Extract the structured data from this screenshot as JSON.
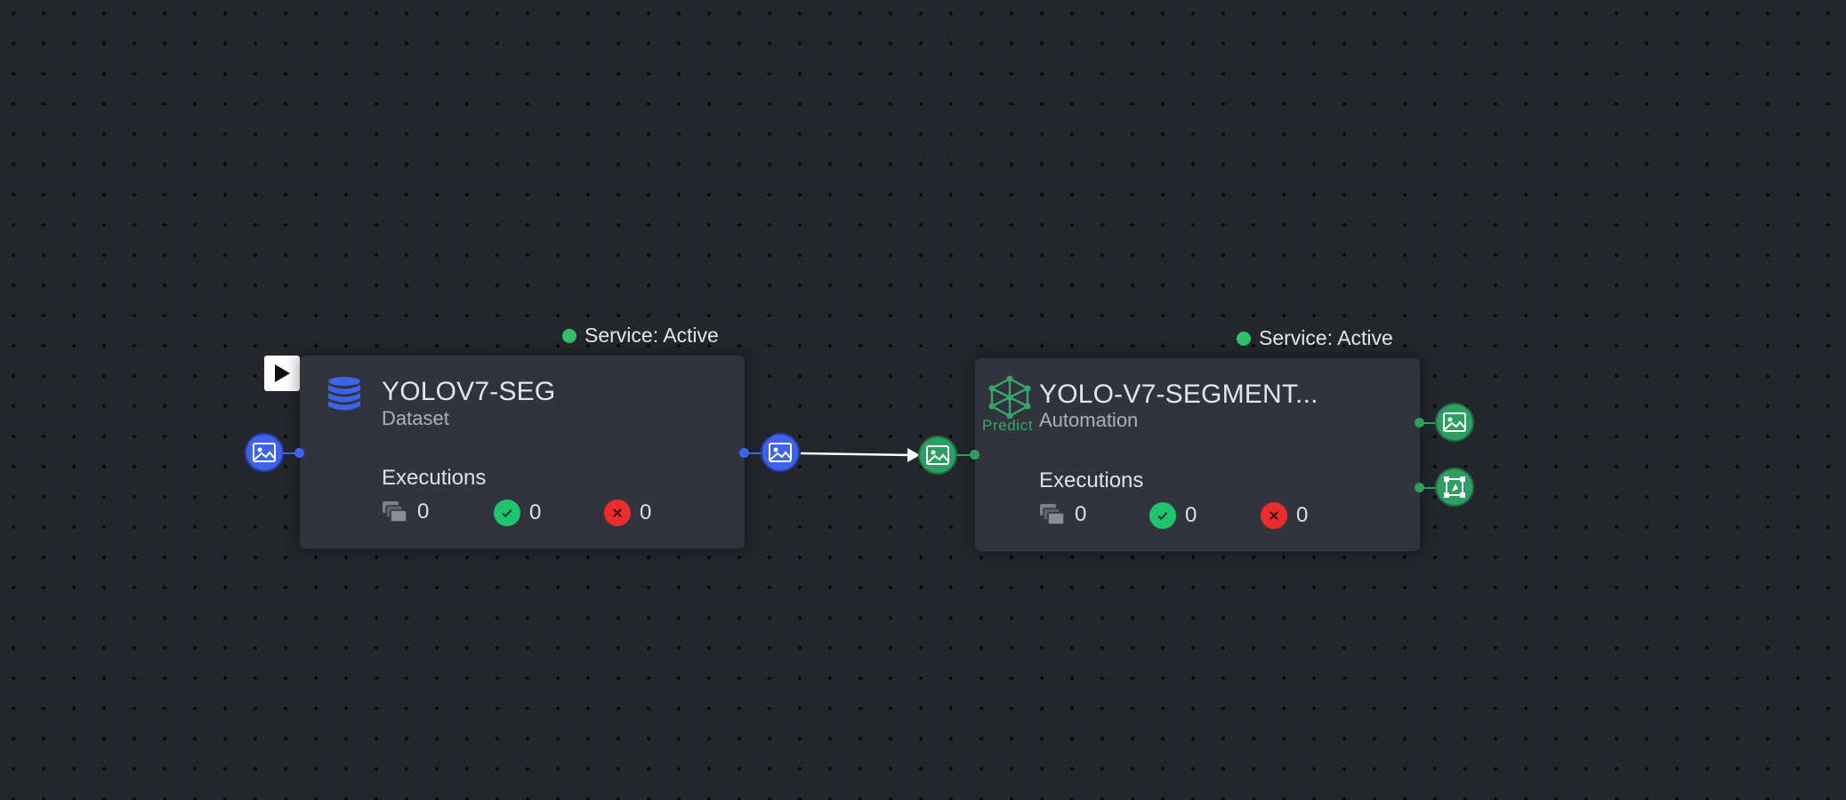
{
  "nodes": [
    {
      "title": "YOLOV7-SEG",
      "subtitle": "Dataset",
      "status": "Service: Active",
      "executions_label": "Executions",
      "counts": {
        "total": "0",
        "success": "0",
        "failed": "0"
      },
      "icon": "database-icon",
      "accent": "#3d63e8"
    },
    {
      "title": "YOLO-V7-SEGMENT...",
      "subtitle": "Automation",
      "status": "Service: Active",
      "executions_label": "Executions",
      "counts": {
        "total": "0",
        "success": "0",
        "failed": "0"
      },
      "icon": "neural-network-icon",
      "badge_label": "Predict",
      "accent": "#2f9e62"
    }
  ],
  "colors": {
    "canvas_bg": "#23262b",
    "node_bg": "#31343d",
    "active": "#2fc26b",
    "success": "#20c46f",
    "error": "#eb2c2c"
  }
}
